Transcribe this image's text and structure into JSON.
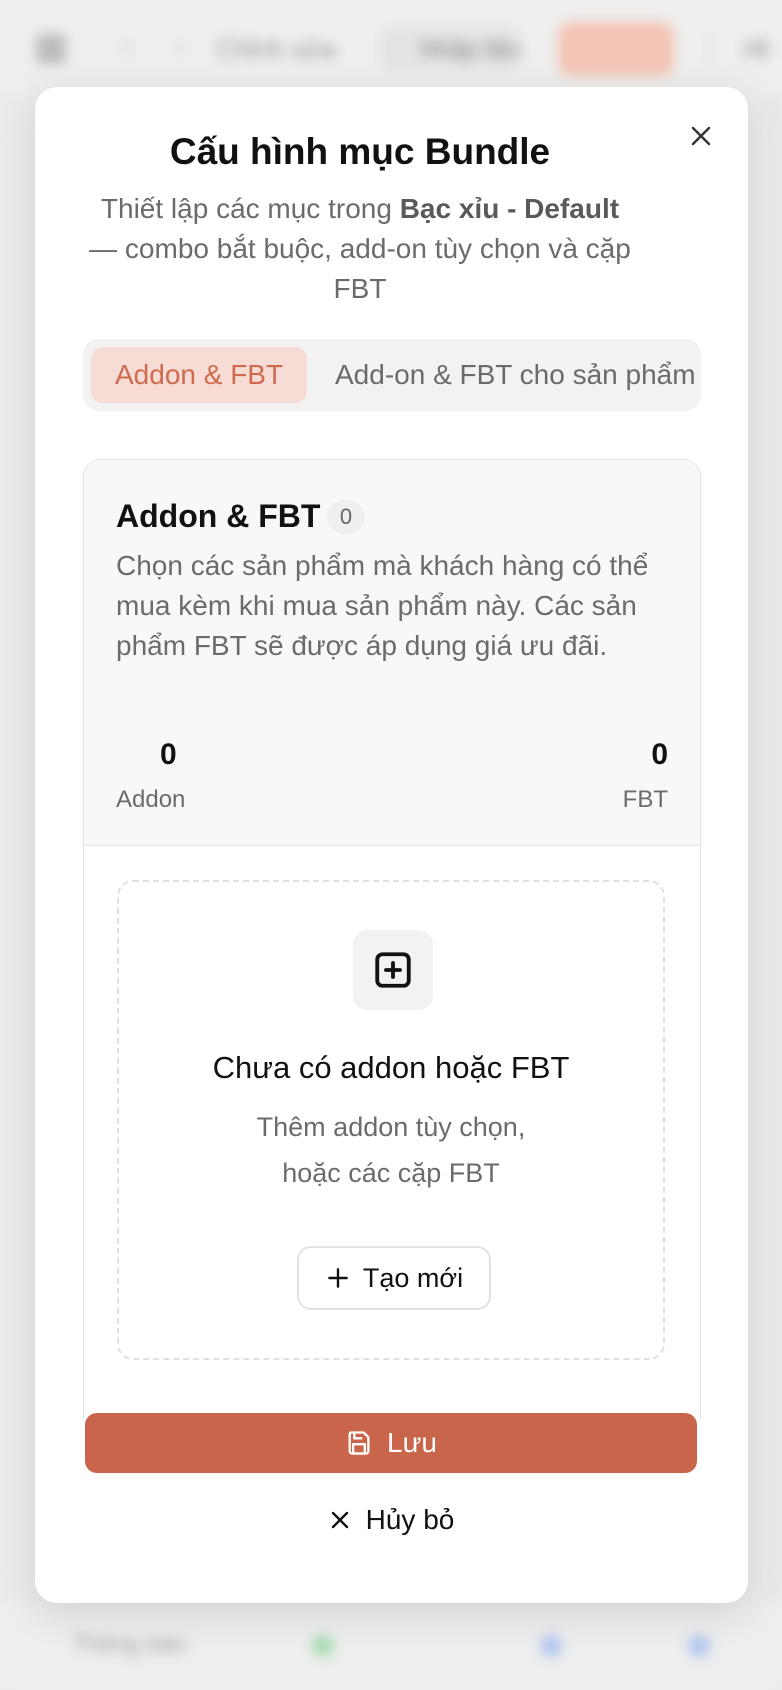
{
  "background": {
    "breadcrumb": "Chỉnh sửa",
    "pill_label": "Nhập liệu",
    "right_text": "Hì",
    "bottom_text": "Thông báo"
  },
  "modal": {
    "title": "Cấu hình mục Bundle",
    "description_prefix": "Thiết lập các mục trong ",
    "description_bold": "Bạc xỉu - Default",
    "description_suffix": " — combo bắt buộc, add-on tùy chọn và cặp FBT",
    "close_icon": "close-icon"
  },
  "tabs": [
    {
      "label": "Addon & FBT",
      "active": true
    },
    {
      "label": "Add-on & FBT cho sản phẩm",
      "active": false
    }
  ],
  "section": {
    "title": "Addon & FBT",
    "count": "0",
    "description": "Chọn các sản phẩm mà khách hàng có thể mua kèm khi mua sản phẩm này. Các sản phẩm FBT sẽ được áp dụng giá ưu đãi.",
    "stats": {
      "addon_value": "0",
      "addon_label": "Addon",
      "fbt_value": "0",
      "fbt_label": "FBT"
    }
  },
  "empty_state": {
    "icon": "plus-square-icon",
    "title": "Chưa có addon hoặc FBT",
    "desc_line1": "Thêm addon tùy chọn,",
    "desc_line2": "hoặc các cặp FBT",
    "create_label": "Tạo mới"
  },
  "footer": {
    "save_label": "Lưu",
    "cancel_label": "Hủy bỏ"
  },
  "colors": {
    "accent": "#c9654a",
    "tab_active_bg": "#f6dcd4",
    "tab_active_text": "#cf6a4e"
  }
}
